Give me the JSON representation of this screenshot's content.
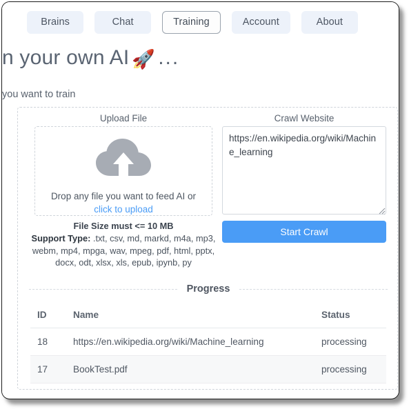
{
  "nav": {
    "tabs": [
      {
        "label": "Brains",
        "active": false
      },
      {
        "label": "Chat",
        "active": false
      },
      {
        "label": "Training",
        "active": true
      },
      {
        "label": "Account",
        "active": false
      },
      {
        "label": "About",
        "active": false
      }
    ]
  },
  "header": {
    "title_visible": "n your own AI",
    "title_emoji": "🚀",
    "title_trailing": "...",
    "subtitle_visible": "you want to train"
  },
  "upload": {
    "section_label": "Upload File",
    "icon": "cloud-upload-icon",
    "drop_text_main": "Drop any file you want to feed AI or ",
    "drop_text_link": "click to upload",
    "file_size_note": "File Size must <= 10 MB",
    "support_label": "Support Type:",
    "support_types": ".txt, csv, md, markd, m4a, mp3, webm, mp4, mpga, wav, mpeg, pdf, html, pptx, docx, odt, xlsx, xls, epub, ipynb, py"
  },
  "crawl": {
    "section_label": "Crawl Website",
    "url_value": "https://en.wikipedia.org/wiki/Machine_learning",
    "url_placeholder": "https://",
    "button_label": "Start Crawl"
  },
  "progress": {
    "title": "Progress",
    "columns": [
      "ID",
      "Name",
      "Status"
    ],
    "rows": [
      {
        "id": "18",
        "name": "https://en.wikipedia.org/wiki/Machine_learning",
        "status": "processing"
      },
      {
        "id": "17",
        "name": "BookTest.pdf",
        "status": "processing"
      }
    ]
  },
  "colors": {
    "accent_blue": "#4a9cf6",
    "tab_bg": "#edf2fa",
    "scrollbar": "#6fd2dd",
    "cloud_gray": "#a7acb4"
  }
}
